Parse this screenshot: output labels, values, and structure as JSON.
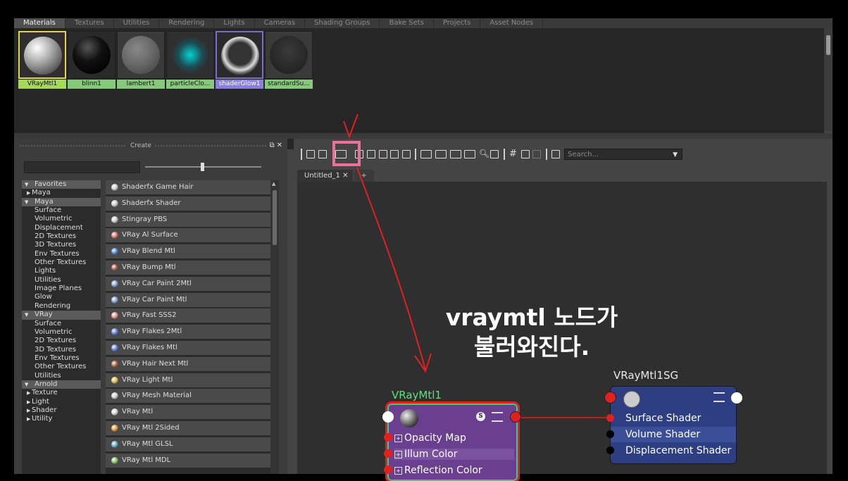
{
  "tabs": [
    "Materials",
    "Textures",
    "Utilities",
    "Rendering",
    "Lights",
    "Cameras",
    "Shading Groups",
    "Bake Sets",
    "Projects",
    "Asset Nodes"
  ],
  "active_tab": "Materials",
  "swatches": [
    {
      "label": "VRayMtl1",
      "style": "checker-gray"
    },
    {
      "label": "blinn1",
      "style": "black"
    },
    {
      "label": "lambert1",
      "style": "gray"
    },
    {
      "label": "particleClo...",
      "style": "checker-cyan"
    },
    {
      "label": "shaderGlow1",
      "style": "glow"
    },
    {
      "label": "standardSu...",
      "style": "dark"
    }
  ],
  "create_panel": {
    "title": "Create",
    "float_icon": "float-icon",
    "close_icon": "close-icon"
  },
  "tree": [
    {
      "label": "Favorites",
      "level": 0,
      "header": true,
      "toggle": "▼"
    },
    {
      "label": "Maya",
      "level": 1,
      "header": false,
      "toggle": "▶"
    },
    {
      "label": "Maya",
      "level": 0,
      "header": true,
      "toggle": "▼"
    },
    {
      "label": "Surface",
      "level": 2
    },
    {
      "label": "Volumetric",
      "level": 2
    },
    {
      "label": "Displacement",
      "level": 2
    },
    {
      "label": "2D Textures",
      "level": 2
    },
    {
      "label": "3D Textures",
      "level": 2
    },
    {
      "label": "Env Textures",
      "level": 2
    },
    {
      "label": "Other Textures",
      "level": 2
    },
    {
      "label": "Lights",
      "level": 2
    },
    {
      "label": "Utilities",
      "level": 2
    },
    {
      "label": "Image Planes",
      "level": 2
    },
    {
      "label": "Glow",
      "level": 2
    },
    {
      "label": "Rendering",
      "level": 2
    },
    {
      "label": "VRay",
      "level": 0,
      "header": true,
      "toggle": "▼"
    },
    {
      "label": "Surface",
      "level": 2
    },
    {
      "label": "Volumetric",
      "level": 2
    },
    {
      "label": "2D Textures",
      "level": 2
    },
    {
      "label": "3D Textures",
      "level": 2
    },
    {
      "label": "Env Textures",
      "level": 2
    },
    {
      "label": "Other Textures",
      "level": 2
    },
    {
      "label": "Utilities",
      "level": 2
    },
    {
      "label": "Arnold",
      "level": 0,
      "header": true,
      "toggle": "▼"
    },
    {
      "label": "Texture",
      "level": 1,
      "toggle": "▶"
    },
    {
      "label": "Light",
      "level": 1,
      "toggle": "▶"
    },
    {
      "label": "Shader",
      "level": 1,
      "toggle": "▶"
    },
    {
      "label": "Utility",
      "level": 1,
      "toggle": "▶"
    }
  ],
  "nodes_list": [
    {
      "label": "Shaderfx Game Hair",
      "color": "#cfcfcf"
    },
    {
      "label": "Shaderfx Shader",
      "color": "#cfcfcf"
    },
    {
      "label": "Stingray PBS",
      "color": "#cfcfcf"
    },
    {
      "label": "VRay Al Surface",
      "color": "#e07a6a"
    },
    {
      "label": "VRay Blend Mtl",
      "color": "#5a8ad8"
    },
    {
      "label": "VRay Bump Mtl",
      "color": "#b05a4a"
    },
    {
      "label": "VRay Car Paint 2Mtl",
      "color": "#8aa8d8"
    },
    {
      "label": "VRay Car Paint Mtl",
      "color": "#8aa8d8"
    },
    {
      "label": "VRay Fast SSS2",
      "color": "#e09a8a"
    },
    {
      "label": "VRay Flakes 2Mtl",
      "color": "#6a8ae0"
    },
    {
      "label": "VRay Flakes Mtl",
      "color": "#6a8ae0"
    },
    {
      "label": "VRay Hair Next Mtl",
      "color": "#b06a4a"
    },
    {
      "label": "VRay Light Mtl",
      "color": "#e0c050"
    },
    {
      "label": "VRay Mesh Material",
      "color": "#cfcfcf"
    },
    {
      "label": "VRay Mtl",
      "color": "#d8d8d8"
    },
    {
      "label": "VRay Mtl 2Sided",
      "color": "#e0a040"
    },
    {
      "label": "VRay Mtl GLSL",
      "color": "#6ab0d0"
    },
    {
      "label": "VRay Mtl MDL",
      "color": "#8ac86a"
    }
  ],
  "search": {
    "placeholder": "Search..."
  },
  "graph_tabs": [
    {
      "label": "Untitled_1",
      "close": "✕"
    },
    {
      "label": "+"
    }
  ],
  "annotation": {
    "line1": "vraymtl 노드가",
    "line2": "불러와진다.",
    "arrow_mark": "V"
  },
  "node1": {
    "title": "VRayMtl1",
    "ports": [
      "Opacity Map",
      "Illum Color",
      "Reflection Color"
    ],
    "badge": "S"
  },
  "node2": {
    "title": "VRayMtl1SG",
    "ports": [
      "Surface Shader",
      "Volume Shader",
      "Displacement Shader"
    ]
  },
  "colors": {
    "node1_bg": "#6a3f8f",
    "node1_border": "#33d08c",
    "node2_bg": "#2d3f82",
    "highlight": "#e47599",
    "annotation_red": "#e41f1f",
    "node1_title": "#5fe07a",
    "node2_title": "#e8e8e8"
  }
}
